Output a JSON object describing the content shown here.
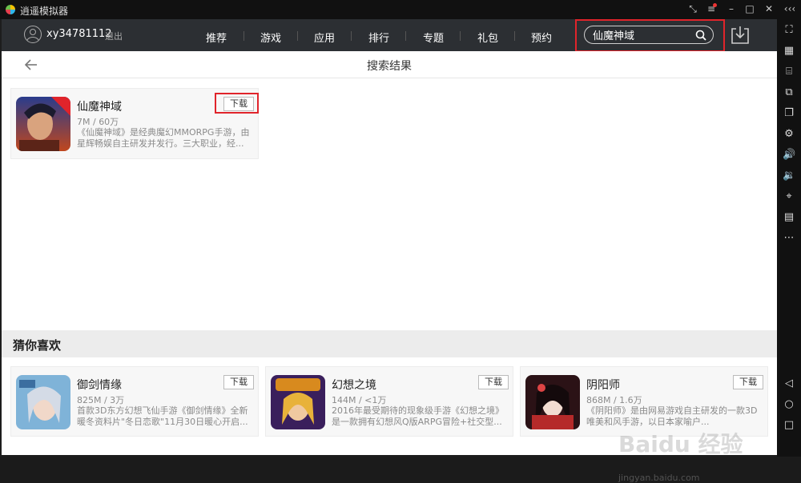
{
  "window": {
    "title": "逍遥模拟器"
  },
  "nav": {
    "username": "xy34781112",
    "logout": "退出",
    "items": [
      "推荐",
      "游戏",
      "应用",
      "排行",
      "专题",
      "礼包",
      "预约"
    ],
    "search_value": "仙魔神域"
  },
  "page": {
    "title": "搜索结果"
  },
  "results": [
    {
      "name": "仙魔神域",
      "meta": "7M / 60万",
      "desc": "《仙魔神域》是经典魔幻MMORPG手游，由星辉畅娱自主研发并发行。三大职业，经...",
      "download": "下载",
      "icon_badge": "首发"
    }
  ],
  "recommend": {
    "title": "猜你喜欢",
    "items": [
      {
        "name": "御剑情缘",
        "meta": "825M / 3万",
        "desc": "首款3D东方幻想飞仙手游《御剑情缘》全新暖冬资料片\"冬日恋歌\"11月30日暖心开启...",
        "download": "下载"
      },
      {
        "name": "幻想之境",
        "meta": "144M / <1万",
        "desc": "2016年最受期待的现象级手游《幻想之境》是一款拥有幻想风Q版ARPG冒险+社交型...",
        "download": "下载"
      },
      {
        "name": "阴阳师",
        "meta": "868M / 1.6万",
        "desc": "《阴阳师》是由网易游戏自主研发的一款3D唯美和风手游，以日本家喻户...",
        "download": "下载"
      }
    ]
  },
  "watermark": {
    "brand": "Baidu 经验",
    "url": "jingyan.baidu.com"
  },
  "colors": {
    "highlight": "#e0242b",
    "nav_bg": "#2c2f33",
    "titlebar_bg": "#111111"
  }
}
